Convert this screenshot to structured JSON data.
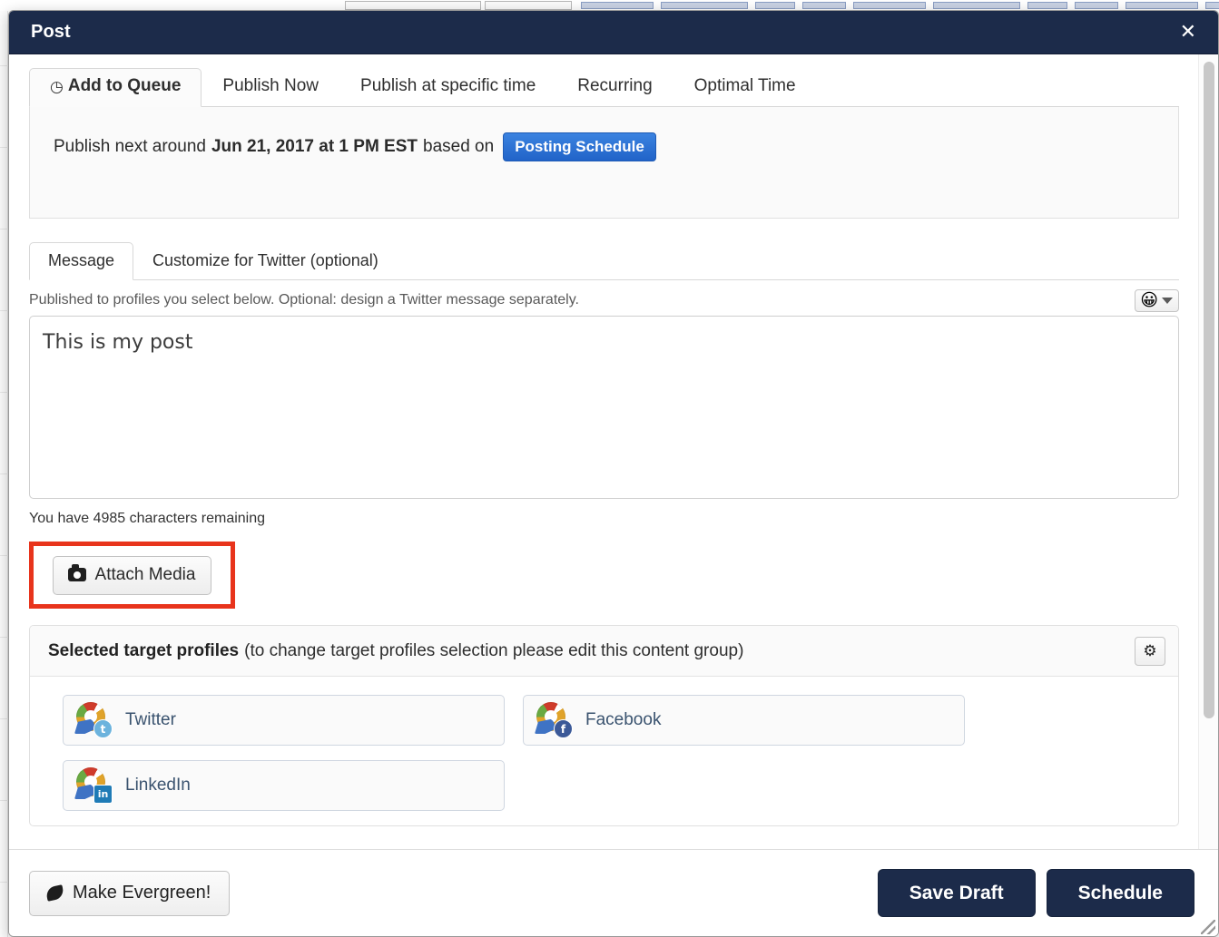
{
  "window": {
    "title": "Post",
    "close_label": "✕"
  },
  "tabs": [
    {
      "label": "Add to Queue",
      "icon": "clock-icon",
      "active": true
    },
    {
      "label": "Publish Now",
      "active": false
    },
    {
      "label": "Publish at specific time",
      "active": false
    },
    {
      "label": "Recurring",
      "active": false
    },
    {
      "label": "Optimal Time",
      "active": false
    }
  ],
  "schedule": {
    "prefix": "Publish next around",
    "datetime": "Jun 21, 2017 at 1 PM EST",
    "suffix": "based on",
    "button_label": "Posting Schedule",
    "button_color": "#2a6fd4"
  },
  "message": {
    "tabs": [
      {
        "label": "Message",
        "active": true
      },
      {
        "label": "Customize for Twitter (optional)",
        "active": false
      }
    ],
    "helper_text": "Published to profiles you select below. Optional: design a Twitter message separately.",
    "emoji_button_icon": "😀",
    "textarea_value": "This is my post",
    "textarea_placeholder": "",
    "char_count": "You have 4985 characters remaining"
  },
  "attach": {
    "button_label": "Attach Media",
    "highlight_color": "#e8341c"
  },
  "profiles": {
    "title_strong": "Selected target profiles",
    "title_rest": "(to change target profiles selection please edit this content group)",
    "gear_icon": "⚙",
    "items": [
      {
        "name": "Twitter",
        "network": "twitter",
        "badge": "t"
      },
      {
        "name": "Facebook",
        "network": "facebook",
        "badge": "f"
      },
      {
        "name": "LinkedIn",
        "network": "linkedin",
        "badge": "in"
      }
    ]
  },
  "footer": {
    "evergreen_label": "Make Evergreen!",
    "save_draft_label": "Save Draft",
    "schedule_label": "Schedule"
  }
}
